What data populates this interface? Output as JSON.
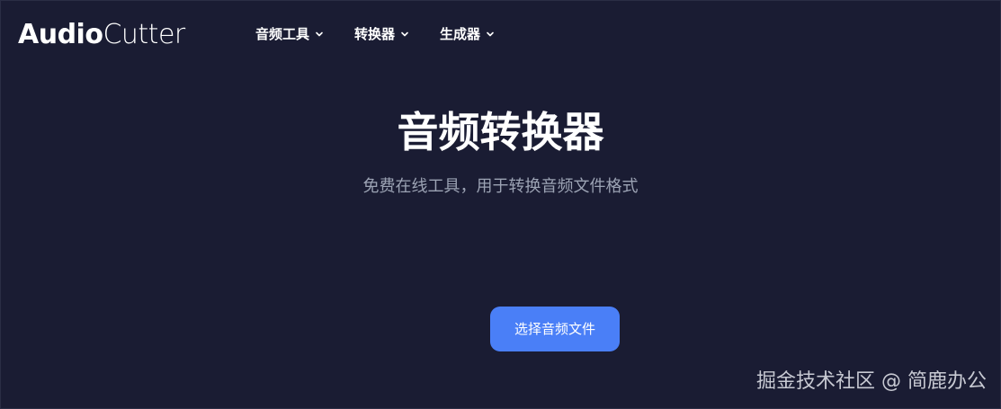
{
  "header": {
    "logo": {
      "bold": "Audio",
      "light": "Cutter"
    },
    "nav": [
      {
        "label": "音频工具"
      },
      {
        "label": "转换器"
      },
      {
        "label": "生成器"
      }
    ]
  },
  "hero": {
    "title": "音频转换器",
    "subtitle": "免费在线工具，用于转换音频文件格式",
    "cta_label": "选择音频文件"
  },
  "watermark": "掘金技术社区 @ 简鹿办公",
  "colors": {
    "background": "#1a1c33",
    "accent": "#4a7ff7",
    "subtitle": "#9ca3b4"
  },
  "icons": {
    "nav_dropdown": "chevron-down-icon"
  }
}
